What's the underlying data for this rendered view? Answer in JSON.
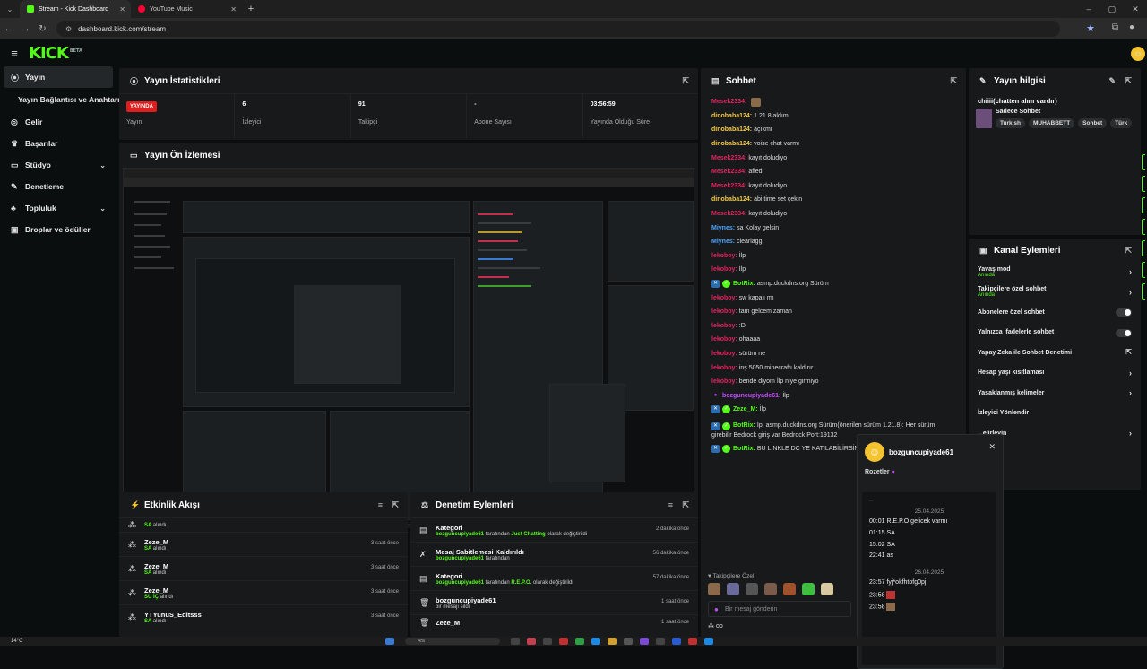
{
  "browser": {
    "tabs": [
      {
        "label": "Stream - Kick Dashboard",
        "color": "#53fc18"
      },
      {
        "label": "YouTube Music",
        "color": "#ff0033"
      }
    ],
    "url": "dashboard.kick.com/stream"
  },
  "app": {
    "logo": "KICK",
    "logo_badge": "BETA"
  },
  "sidebar": {
    "items": [
      {
        "label": "Yayın",
        "icon": "broadcast-icon"
      },
      {
        "label": "Yayın Bağlantısı ve Anahtarı"
      },
      {
        "label": "Gelir",
        "icon": "money-icon"
      },
      {
        "label": "Başarılar",
        "icon": "trophy-icon"
      },
      {
        "label": "Stüdyo",
        "icon": "studio-icon"
      },
      {
        "label": "Denetleme",
        "icon": "wrench-icon"
      },
      {
        "label": "Topluluk",
        "icon": "community-icon"
      },
      {
        "label": "Droplar ve ödüller",
        "icon": "gift-icon"
      }
    ]
  },
  "stats": {
    "title": "Yayın İstatistikleri",
    "live_badge": "YAYINDA",
    "live_label": "Yayın",
    "viewers_value": "6",
    "viewers_label": "İzleyici",
    "followers_value": "91",
    "followers_label": "Takipçi",
    "subs_value": "-",
    "subs_label": "Abone Sayısı",
    "uptime_value": "03:56:59",
    "uptime_label": "Yayında Olduğu Süre"
  },
  "preview": {
    "title": "Yayın Ön İzlemesi"
  },
  "chat": {
    "title": "Sohbet",
    "messages": [
      {
        "user": "Mesek2334:",
        "color": "#e0245e",
        "text": "",
        "badge": ""
      },
      {
        "user": "dinobaba124:",
        "color": "#f2c94c",
        "text": "1.21.8 aldım",
        "badge": ""
      },
      {
        "user": "dinobaba124:",
        "color": "#f2c94c",
        "text": "açıkmı",
        "badge": ""
      },
      {
        "user": "dinobaba124:",
        "color": "#f2c94c",
        "text": "voise chat varmı",
        "badge": ""
      },
      {
        "user": "Mesek2334:",
        "color": "#e0245e",
        "text": "kayıt doludiyo",
        "badge": ""
      },
      {
        "user": "Mesek2334:",
        "color": "#e0245e",
        "text": "afied",
        "badge": ""
      },
      {
        "user": "Mesek2334:",
        "color": "#e0245e",
        "text": "kayıt doludiyo",
        "badge": ""
      },
      {
        "user": "dinobaba124:",
        "color": "#f2c94c",
        "text": "abi time set çekin",
        "badge": ""
      },
      {
        "user": "Mesek2334:",
        "color": "#e0245e",
        "text": "kayıt doludiyo",
        "badge": ""
      },
      {
        "user": "Miynes:",
        "color": "#4aa3ff",
        "text": "sa Kolay gelsin",
        "badge": ""
      },
      {
        "user": "Miynes:",
        "color": "#4aa3ff",
        "text": "clearlagg",
        "badge": ""
      },
      {
        "user": "lekoboy:",
        "color": "#e0245e",
        "text": "İlp",
        "badge": ""
      },
      {
        "user": "lekoboy:",
        "color": "#e0245e",
        "text": "İlp",
        "badge": ""
      },
      {
        "user": "BotRix:",
        "color": "#53fc18",
        "text": "asmp.duckdns.org Sürüm",
        "badge": "bot"
      },
      {
        "user": "lekoboy:",
        "color": "#e0245e",
        "text": "sw kapalı mı",
        "badge": ""
      },
      {
        "user": "lekoboy:",
        "color": "#e0245e",
        "text": "tam gelcem zaman",
        "badge": ""
      },
      {
        "user": "lekoboy:",
        "color": "#e0245e",
        "text": ":D",
        "badge": ""
      },
      {
        "user": "lekoboy:",
        "color": "#e0245e",
        "text": "ohaaaa",
        "badge": ""
      },
      {
        "user": "lekoboy:",
        "color": "#e0245e",
        "text": "sürüm ne",
        "badge": ""
      },
      {
        "user": "lekoboy:",
        "color": "#e0245e",
        "text": "inş 5050 minecraftı kaldırır",
        "badge": ""
      },
      {
        "user": "lekoboy:",
        "color": "#e0245e",
        "text": "bende diyom İlp niye girmiyo",
        "badge": ""
      },
      {
        "user": "bozguncupiyade61:",
        "color": "#c44bff",
        "text": "İlp",
        "badge": "mic"
      },
      {
        "user": "Zeze_M:",
        "color": "#53fc18",
        "text": "İlp",
        "badge": "bot"
      }
    ],
    "long_message": {
      "user": "BotRix:",
      "text": "İp: asmp.duckdns.org Sürüm(önerilen sürüm 1.21.8): Her sürüm girebilir Bedrock giriş var Bedrock Port:19132"
    },
    "last_message": {
      "user": "BotRix:",
      "text": "BU LİNKLE DC YE KATILABİLİRSİNİ"
    },
    "followers_label": "Takipçilere Özel",
    "input_placeholder": "Bir mesaj gönderin",
    "footer_text": "oo"
  },
  "user_card": {
    "username": "bozguncupiyade61",
    "badges_label": "Rozetler",
    "top_text": "...",
    "date1": "25.04.2025",
    "msgs1": [
      "00:01 R.E.P.O gelicek varmı",
      "01:15 SA",
      "15:02 SA",
      "22:41 as"
    ],
    "date2": "26.04.2025",
    "msgs2": [
      "23:57 fyj*okfhtofg0pj",
      "23:58",
      "23:58"
    ]
  },
  "info": {
    "title": "Yayın bilgisi",
    "stream_title": "chiiii(chatten alım vardır)",
    "category": "Sadece Sohbet",
    "tags": [
      "Turkish",
      "MUHABBETT",
      "Sohbet",
      "Türk"
    ]
  },
  "channel_actions": {
    "title": "Kanal Eylemleri",
    "items": [
      {
        "label": "Yavaş mod",
        "sub": "Anında",
        "kind": "chev"
      },
      {
        "label": "Takipçilere özel sohbet",
        "sub": "Anında",
        "kind": "chev"
      },
      {
        "label": "Abonelere özel sohbet",
        "sub": "",
        "kind": "toggle"
      },
      {
        "label": "Yalnızca ifadelerle sohbet",
        "sub": "",
        "kind": "toggle"
      },
      {
        "label": "Yapay Zeka ile Sohbet Denetimi",
        "sub": "",
        "kind": "ext"
      },
      {
        "label": "Hesap yaşı kısıtlaması",
        "sub": "",
        "kind": "chev"
      },
      {
        "label": "Yasaklanmış kelimeler",
        "sub": "",
        "kind": "chev"
      },
      {
        "label": "İzleyici Yönlendir",
        "sub": "",
        "kind": "none"
      },
      {
        "label": "...elirleyin",
        "sub": "",
        "kind": "chev"
      }
    ]
  },
  "event_feed": {
    "title": "Etkinlik Akışı",
    "items": [
      {
        "name": "",
        "action": "SA",
        "suffix": "alındı",
        "time": ""
      },
      {
        "name": "Zeze_M",
        "action": "SA",
        "suffix": "alındı",
        "time": "3 saat önce"
      },
      {
        "name": "Zeze_M",
        "action": "SA",
        "suffix": "alındı",
        "time": "3 saat önce"
      },
      {
        "name": "Zeze_M",
        "action": "SU İÇ",
        "suffix": "alındı",
        "time": "3 saat önce"
      },
      {
        "name": "YTYunuS_Editsss",
        "action": "SA",
        "suffix": "alındı",
        "time": "3 saat önce"
      }
    ]
  },
  "mod_actions": {
    "title": "Denetim Eylemleri",
    "items": [
      {
        "name": "Kategori",
        "user": "bozguncupiyade61",
        "mid": "tarafından",
        "value": "Just Chatting",
        "end": "olarak değiştirildi",
        "time": "2 dakika önce",
        "icon": "category-icon"
      },
      {
        "name": "Mesaj Sabitlemesi Kaldırıldı",
        "user": "bozguncupiyade61",
        "mid": "tarafından",
        "value": "",
        "end": "",
        "time": "56 dakika önce",
        "icon": "unpin-icon"
      },
      {
        "name": "Kategori",
        "user": "bozguncupiyade61",
        "mid": "tarafından",
        "value": "R.E.P.O.",
        "end": "olarak değiştirildi",
        "time": "57 dakika önce",
        "icon": "category-icon"
      },
      {
        "name": "bozguncupiyade61",
        "user": "",
        "mid": "bir mesajı sildi",
        "value": "",
        "end": "",
        "time": "1 saat önce",
        "icon": "trash-icon"
      },
      {
        "name": "Zeze_M",
        "user": "",
        "mid": "",
        "value": "",
        "end": "",
        "time": "1 saat önce",
        "icon": "trash-icon"
      }
    ]
  },
  "taskbar": {
    "weather": "14°C",
    "search": "Ara"
  },
  "colors": {
    "accent": "#53fc18",
    "live": "#e01e1e"
  }
}
